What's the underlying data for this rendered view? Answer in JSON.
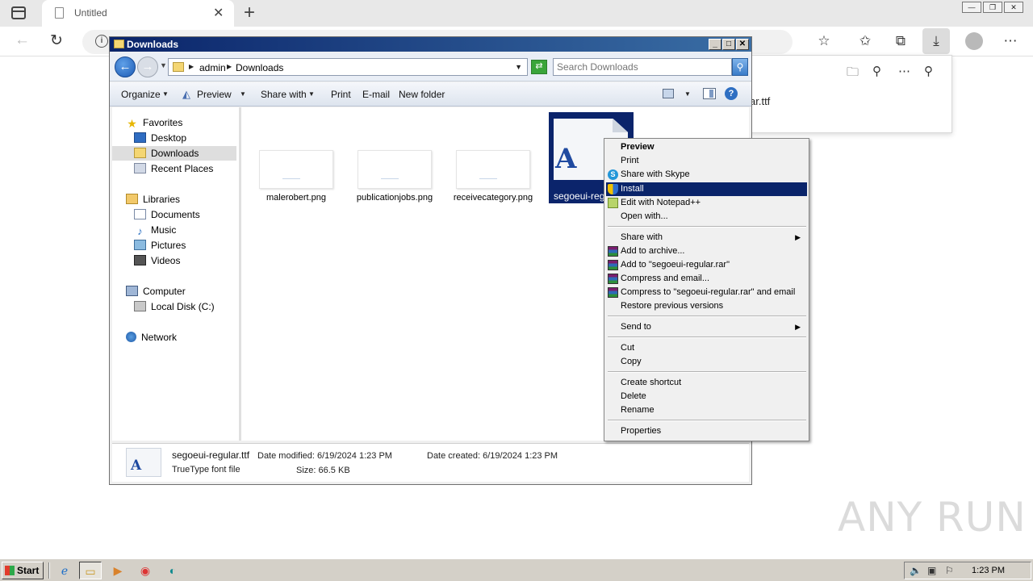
{
  "browser": {
    "tab_title": "Untitled",
    "tab_close": "✕",
    "new_tab": "+",
    "downloads_partial_filename": "ar.ttf"
  },
  "explorer": {
    "title": "Downloads",
    "breadcrumb": [
      "admin",
      "Downloads"
    ],
    "search_placeholder": "Search Downloads",
    "commands": {
      "organize": "Organize",
      "preview": "Preview",
      "share_with": "Share with",
      "print": "Print",
      "email": "E-mail",
      "new_folder": "New folder"
    },
    "nav": {
      "favorites": "Favorites",
      "desktop": "Desktop",
      "downloads": "Downloads",
      "recent_places": "Recent Places",
      "libraries": "Libraries",
      "documents": "Documents",
      "music": "Music",
      "pictures": "Pictures",
      "videos": "Videos",
      "computer": "Computer",
      "local_disk": "Local Disk (C:)",
      "network": "Network"
    },
    "files": [
      {
        "name": "malerobert.png"
      },
      {
        "name": "publicationjobs.png"
      },
      {
        "name": "receivecategory.png"
      },
      {
        "name": "segoeui-regul"
      }
    ],
    "font_glyph": "A",
    "details": {
      "name": "segoeui-regular.ttf",
      "type": "TrueType font file",
      "date_modified": "Date modified: 6/19/2024 1:23 PM",
      "date_created": "Date created: 6/19/2024 1:23 PM",
      "size": "Size: 66.5 KB"
    }
  },
  "context_menu": {
    "preview": "Preview",
    "print": "Print",
    "share_with_skype": "Share with Skype",
    "install": "Install",
    "edit_notepadpp": "Edit with Notepad++",
    "open_with": "Open with...",
    "share_with": "Share with",
    "add_to_archive": "Add to archive...",
    "add_to_rar": "Add to \"segoeui-regular.rar\"",
    "compress_email": "Compress and email...",
    "compress_rar_email": "Compress to \"segoeui-regular.rar\" and email",
    "restore_versions": "Restore previous versions",
    "send_to": "Send to",
    "cut": "Cut",
    "copy": "Copy",
    "create_shortcut": "Create shortcut",
    "delete": "Delete",
    "rename": "Rename",
    "properties": "Properties"
  },
  "taskbar": {
    "start": "Start",
    "clock": "1:23 PM"
  },
  "watermark": {
    "text": "ANY RUN"
  },
  "colors": {
    "titlebar": "#0a246a",
    "selection": "#0b246b",
    "menu_highlight": "#0a246a"
  }
}
